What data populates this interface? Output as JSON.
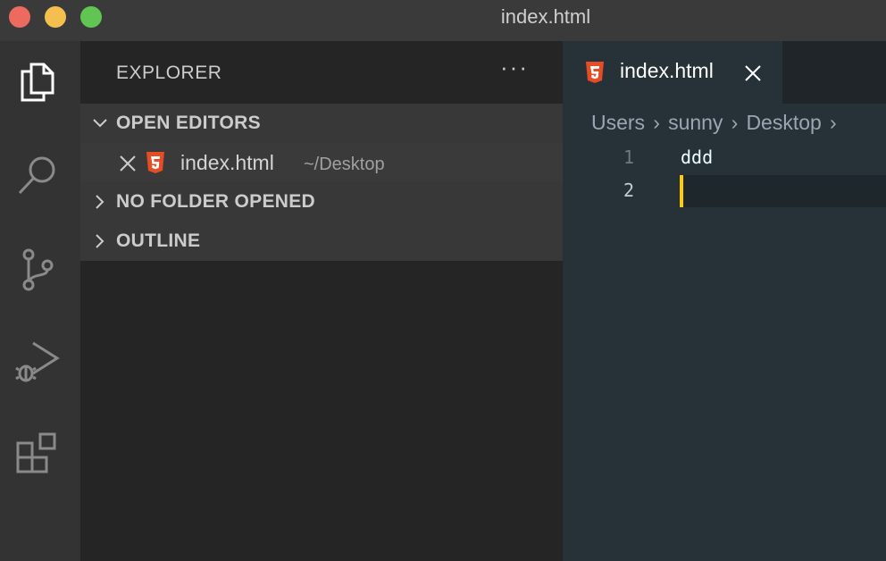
{
  "window": {
    "title": "index.html"
  },
  "activity_bar": {
    "items": [
      "files-icon",
      "search-icon",
      "source-control-icon",
      "run-debug-icon",
      "extensions-icon"
    ]
  },
  "sidebar": {
    "title": "EXPLORER",
    "more_label": "···",
    "sections": {
      "open_editors": "OPEN EDITORS",
      "no_folder": "NO FOLDER OPENED",
      "outline": "OUTLINE"
    },
    "open_editor": {
      "name": "index.html",
      "path": "~/Desktop"
    }
  },
  "editor": {
    "tab": {
      "label": "index.html"
    },
    "breadcrumb": [
      "Users",
      "sunny",
      "Desktop"
    ],
    "lines": [
      {
        "number": "1",
        "text": "ddd"
      },
      {
        "number": "2",
        "text": ""
      }
    ]
  },
  "colors": {
    "html_icon": "#e44d26",
    "cursor": "#ffcc00",
    "editor_bg": "#263238",
    "sidebar_bg": "#252526"
  }
}
